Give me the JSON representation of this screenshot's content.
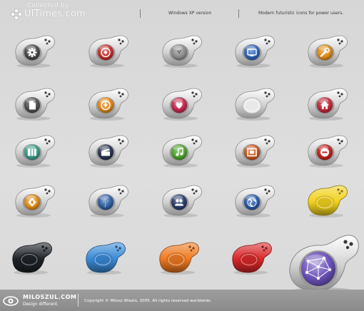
{
  "watermark": {
    "line1": "Collected by",
    "line2": "UITimes.com"
  },
  "header": {
    "version_label": "Windows XP version",
    "tagline": "Modern futuristic icons for power users."
  },
  "footer": {
    "brand": "MILOSZUL.COM",
    "slogan": "Design different.",
    "copyright": "Copyright © Milosz Wlazlo, 2005. All rights reserved worldwide."
  },
  "icons": [
    {
      "name": "settings-gear-icon",
      "color": "#4a4a4a",
      "glyph": "gear"
    },
    {
      "name": "cd-disc-icon",
      "color": "#c0302a",
      "glyph": "disc"
    },
    {
      "name": "bowling-ball-icon",
      "color": "#8c8c8c",
      "glyph": "ball"
    },
    {
      "name": "monitor-icon",
      "color": "#2e63b5",
      "glyph": "monitor"
    },
    {
      "name": "wrench-tools-icon",
      "color": "#de8b17",
      "glyph": "wrench"
    },
    {
      "name": "document-icon",
      "color": "#505050",
      "glyph": "doc"
    },
    {
      "name": "download-icon",
      "color": "#e0861a",
      "glyph": "down"
    },
    {
      "name": "heart-favorites-icon",
      "color": "#c3284e",
      "glyph": "heart"
    },
    {
      "name": "blank-icon",
      "color": "#cfcfcf",
      "glyph": "none"
    },
    {
      "name": "home-icon",
      "color": "#c0283a",
      "glyph": "home"
    },
    {
      "name": "columns-icon",
      "color": "#3a9a86",
      "glyph": "columns"
    },
    {
      "name": "clapperboard-movie-icon",
      "color": "#28354f",
      "glyph": "clapper"
    },
    {
      "name": "music-note-icon",
      "color": "#4ea22a",
      "glyph": "note"
    },
    {
      "name": "picture-frame-icon",
      "color": "#c8541e",
      "glyph": "frame"
    },
    {
      "name": "minus-remove-icon",
      "color": "#c0231e",
      "glyph": "minus"
    },
    {
      "name": "warning-up-icon",
      "color": "#de8b17",
      "glyph": "diamond"
    },
    {
      "name": "finder-face-icon",
      "color": "#2f5f9e",
      "glyph": "face"
    },
    {
      "name": "users-contacts-icon",
      "color": "#2a3d6a",
      "glyph": "users"
    },
    {
      "name": "globe-network-icon",
      "color": "#2a5aa8",
      "glyph": "globe"
    },
    {
      "name": "yellow-blank-icon",
      "color": "#f2d21e",
      "glyph": "flat"
    },
    {
      "name": "black-blank-icon",
      "color": "#1e2328",
      "glyph": "flat"
    },
    {
      "name": "blue-blank-icon",
      "color": "#3a8ad6",
      "glyph": "flat"
    },
    {
      "name": "orange-blank-icon",
      "color": "#ee7a22",
      "glyph": "flat"
    },
    {
      "name": "red-blank-icon",
      "color": "#d8282a",
      "glyph": "flat"
    }
  ],
  "featured_icon": {
    "name": "network-globe-large-icon",
    "color": "#6a50b8"
  }
}
